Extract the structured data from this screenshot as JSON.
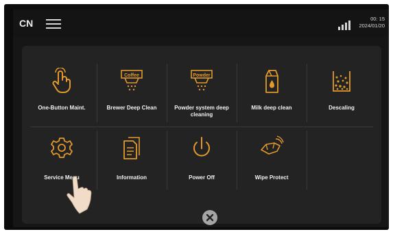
{
  "status_bar": {
    "language": "CN",
    "time": "00: 15",
    "date": "2024/01/20"
  },
  "menu_items": [
    {
      "label": "One-Button Maint.",
      "icon": "hand-tap-icon"
    },
    {
      "label": "Brewer Deep Clean",
      "icon": "brewer-clean-icon"
    },
    {
      "label": "Powder system deep cleaning",
      "icon": "powder-clean-icon"
    },
    {
      "label": "Milk deep clean",
      "icon": "milk-carton-icon"
    },
    {
      "label": "Descaling",
      "icon": "descaling-icon"
    },
    {
      "label": "Service Menu",
      "icon": "gear-icon"
    },
    {
      "label": "Information",
      "icon": "document-icon"
    },
    {
      "label": "Power Off",
      "icon": "power-icon"
    },
    {
      "label": "Wipe Protect",
      "icon": "wipe-hand-icon"
    }
  ],
  "icon_text": {
    "brewer": "Coffee",
    "powder": "Powder"
  },
  "colors": {
    "icon_orange": "#e39a2d",
    "background": "#161616",
    "panel": "#232323",
    "text": "#f1f1f1"
  }
}
